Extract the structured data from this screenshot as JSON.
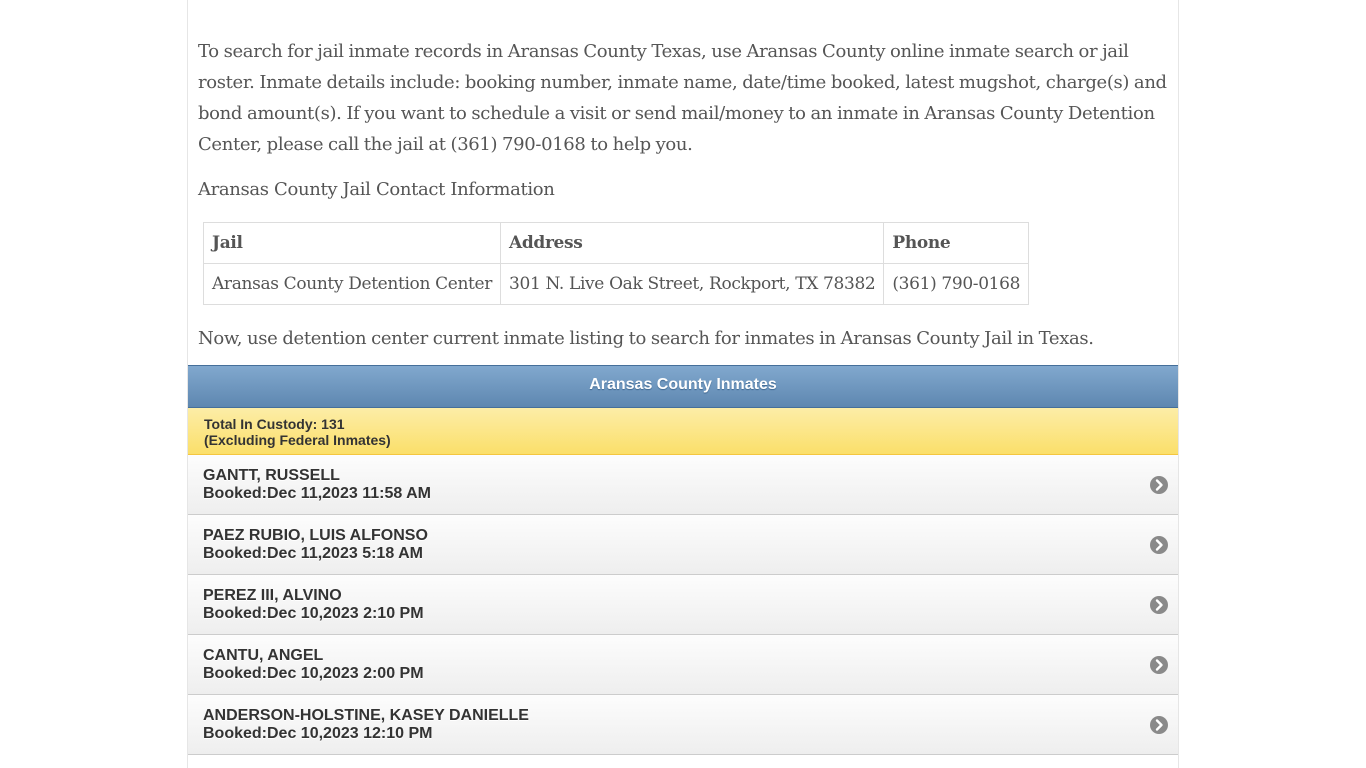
{
  "intro": {
    "text": "To search for jail inmate records in Aransas County Texas, use Aransas County online inmate search or jail roster. Inmate details include: booking number, inmate name, date/time booked, latest mugshot, charge(s) and bond amount(s). If you want to schedule a visit or send mail/money to an inmate in Aransas County Detention Center, please call the jail at (361) 790-0168 to help you."
  },
  "contact": {
    "heading": "Aransas County Jail Contact Information",
    "headers": {
      "jail": "Jail",
      "address": "Address",
      "phone": "Phone"
    },
    "row": {
      "jail": "Aransas County Detention Center",
      "address": "301 N. Live Oak Street, Rockport, TX 78382",
      "phone": "(361) 790-0168"
    }
  },
  "listing_note": "Now, use detention center current inmate listing to search for inmates in Aransas County Jail in Texas.",
  "inmates": {
    "title": "Aransas County Inmates",
    "custody_line1": "Total In Custody: 131",
    "custody_line2": "(Excluding Federal Inmates)",
    "rows": [
      {
        "name": "GANTT, RUSSELL",
        "booked": "Booked:Dec 11,2023 11:58 AM"
      },
      {
        "name": "PAEZ RUBIO, LUIS ALFONSO",
        "booked": "Booked:Dec 11,2023 5:18 AM"
      },
      {
        "name": "PEREZ III, ALVINO",
        "booked": "Booked:Dec 10,2023 2:10 PM"
      },
      {
        "name": "CANTU, ANGEL",
        "booked": "Booked:Dec 10,2023 2:00 PM"
      },
      {
        "name": "ANDERSON-HOLSTINE, KASEY DANIELLE",
        "booked": "Booked:Dec 10,2023 12:10 PM"
      }
    ],
    "row_icon": "chevron-right-circle-icon"
  },
  "colors": {
    "header_blue": "#6f97bf",
    "custody_yellow": "#fbe27a",
    "chevron_gray": "#8a8a8a"
  }
}
